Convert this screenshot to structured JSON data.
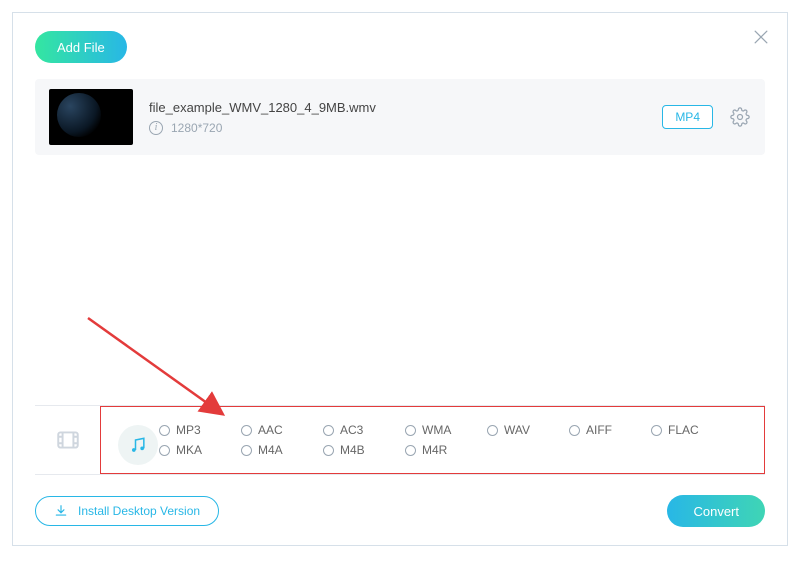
{
  "header": {
    "add_file_label": "Add File"
  },
  "file": {
    "name": "file_example_WMV_1280_4_9MB.wmv",
    "resolution": "1280*720",
    "target_format": "MP4"
  },
  "format_tabs": {
    "video": "video",
    "audio": "audio"
  },
  "audio_formats": {
    "row1": [
      "MP3",
      "AAC",
      "AC3",
      "WMA",
      "WAV",
      "AIFF",
      "FLAC"
    ],
    "row2": [
      "MKA",
      "M4A",
      "M4B",
      "M4R"
    ]
  },
  "footer": {
    "install_label": "Install Desktop Version",
    "convert_label": "Convert"
  }
}
